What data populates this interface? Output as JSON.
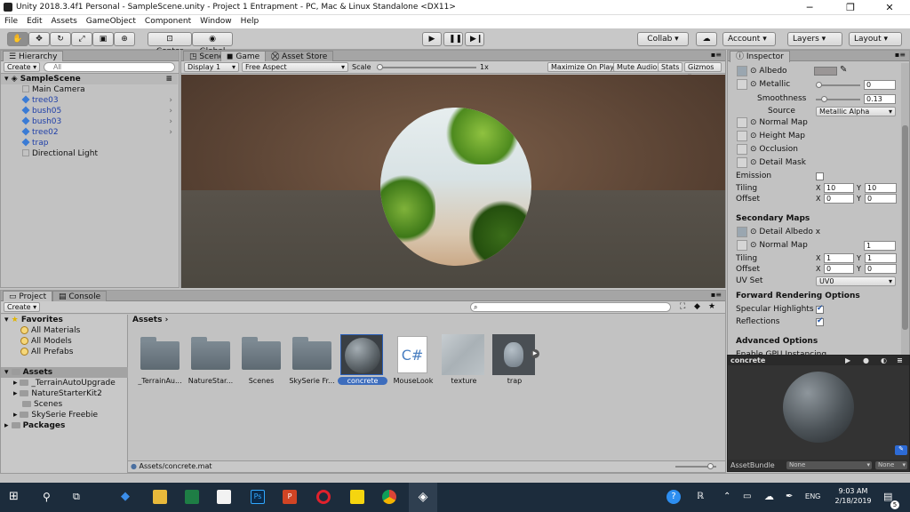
{
  "window": {
    "title": "Unity 2018.3.4f1 Personal - SampleScene.unity - Project 1 Entrapment - PC, Mac & Linux Standalone <DX11>"
  },
  "menu": [
    "File",
    "Edit",
    "Assets",
    "GameObject",
    "Component",
    "Window",
    "Help"
  ],
  "toolbar": {
    "center": "Center",
    "global": "Global",
    "collab": "Collab",
    "account": "Account",
    "layers": "Layers",
    "layout": "Layout"
  },
  "hierarchy": {
    "tab": "Hierarchy",
    "create": "Create",
    "search_placeholder": "All",
    "scene": "SampleScene",
    "items": [
      {
        "label": "Main Camera",
        "type": "ghost"
      },
      {
        "label": "tree03",
        "type": "prefab"
      },
      {
        "label": "bush05",
        "type": "prefab"
      },
      {
        "label": "bush03",
        "type": "prefab"
      },
      {
        "label": "tree02",
        "type": "prefab"
      },
      {
        "label": "trap",
        "type": "prefab"
      },
      {
        "label": "Directional Light",
        "type": "ghost"
      }
    ]
  },
  "center_tabs": {
    "scene": "Scene",
    "game": "Game",
    "store": "Asset Store"
  },
  "game_bar": {
    "display": "Display 1",
    "aspect": "Free Aspect",
    "scale": "Scale",
    "scale_val": "1x",
    "maximize": "Maximize On Play",
    "mute": "Mute Audio",
    "stats": "Stats",
    "gizmos": "Gizmos"
  },
  "inspector": {
    "tab": "Inspector",
    "albedo": "Albedo",
    "metallic": "Metallic",
    "metallic_val": "0",
    "smoothness": "Smoothness",
    "smoothness_val": "0.13",
    "source": "Source",
    "source_val": "Metallic Alpha",
    "normal_map": "Normal Map",
    "height_map": "Height Map",
    "occlusion": "Occlusion",
    "detail_mask": "Detail Mask",
    "emission": "Emission",
    "tiling": "Tiling",
    "offset": "Offset",
    "tiling_x": "10",
    "tiling_y": "10",
    "offset_x": "0",
    "offset_y": "0",
    "secondary": "Secondary Maps",
    "detail_albedo": "Detail Albedo x",
    "normal_map2": "Normal Map",
    "normal_val": "1",
    "tiling2_x": "1",
    "tiling2_y": "1",
    "offset2_x": "0",
    "offset2_y": "0",
    "uvset": "UV Set",
    "uvset_val": "UV0",
    "forward": "Forward Rendering Options",
    "specular": "Specular Highlights",
    "reflections": "Reflections",
    "advanced": "Advanced Options",
    "gpu": "Enable GPU Instancing",
    "x": "X",
    "y": "Y"
  },
  "preview": {
    "name": "concrete",
    "bundle_label": "AssetBundle",
    "bundle_val": "None",
    "variant_val": "None"
  },
  "bottom_tabs": {
    "project": "Project",
    "console": "Console"
  },
  "project": {
    "create": "Create",
    "favorites": "Favorites",
    "fav_items": [
      "All Materials",
      "All Models",
      "All Prefabs"
    ],
    "assets": "Assets",
    "asset_folders": [
      "_TerrainAutoUpgrade",
      "NatureStarterKit2",
      "Scenes",
      "SkySerie Freebie"
    ],
    "packages": "Packages",
    "breadcrumb": "Assets",
    "grid": [
      {
        "label": "_TerrainAu...",
        "kind": "folder"
      },
      {
        "label": "NatureStar...",
        "kind": "folder"
      },
      {
        "label": "Scenes",
        "kind": "folder"
      },
      {
        "label": "SkySerie Fr...",
        "kind": "folder"
      },
      {
        "label": "concrete",
        "kind": "material"
      },
      {
        "label": "MouseLook",
        "kind": "script"
      },
      {
        "label": "texture",
        "kind": "texture"
      },
      {
        "label": "trap",
        "kind": "model"
      }
    ],
    "script_glyph": "C#",
    "status": "Assets/concrete.mat"
  },
  "taskbar": {
    "lang": "ENG",
    "time": "9:03 AM",
    "date": "2/18/2019",
    "notif": "5"
  }
}
